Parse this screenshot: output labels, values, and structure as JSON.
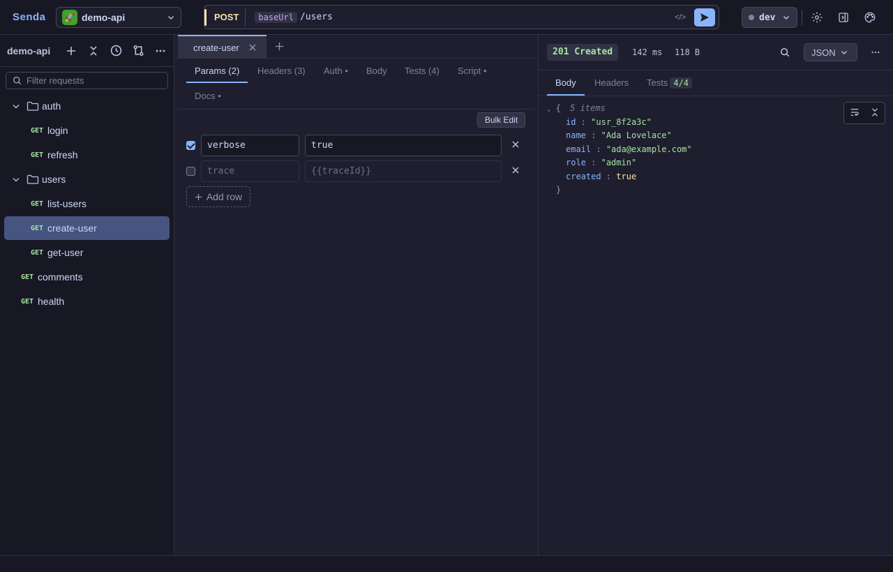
{
  "app": {
    "brand": "Senda"
  },
  "workspace": {
    "name": "demo-api",
    "icon": "rocket-icon"
  },
  "request_bar": {
    "method": "POST",
    "url_var": "baseUrl",
    "url_path": "/users"
  },
  "environment": {
    "name": "dev"
  },
  "sidebar": {
    "title": "demo-api",
    "filter_placeholder": "Filter requests",
    "tree": [
      {
        "type": "folder",
        "name": "auth"
      },
      {
        "type": "request",
        "method": "GET",
        "name": "login"
      },
      {
        "type": "request",
        "method": "GET",
        "name": "refresh"
      },
      {
        "type": "folder",
        "name": "users"
      },
      {
        "type": "request",
        "method": "GET",
        "name": "list-users"
      },
      {
        "type": "request",
        "method": "GET",
        "name": "create-user",
        "active": true
      },
      {
        "type": "request",
        "method": "GET",
        "name": "get-user"
      },
      {
        "type": "request",
        "method": "GET",
        "name": "comments"
      },
      {
        "type": "request",
        "method": "GET",
        "name": "health"
      }
    ]
  },
  "request": {
    "tab_name": "create-user",
    "subtabs": [
      "Params (2)",
      "Headers (3)",
      "Auth •",
      "Body",
      "Tests (4)",
      "Script •",
      "Docs •"
    ],
    "bulk_edit": "Bulk Edit",
    "params": [
      {
        "enabled": true,
        "key": "verbose",
        "value": "true"
      },
      {
        "enabled": false,
        "key": "trace",
        "value": "{{traceId}}"
      }
    ],
    "add_row": "Add row"
  },
  "response": {
    "status": "201 Created",
    "time": "142 ms",
    "size": "118 B",
    "format": "JSON",
    "tabs": [
      "Body",
      "Headers",
      "Tests"
    ],
    "tests_badge": "4/4",
    "json": {
      "summary": "5 items",
      "open": "{",
      "close": "}",
      "fields": [
        {
          "key": "id",
          "value": "\"usr_8f2a3c\"",
          "kind": "string"
        },
        {
          "key": "name",
          "value": "\"Ada Lovelace\"",
          "kind": "string"
        },
        {
          "key": "email",
          "value": "\"ada@example.com\"",
          "kind": "string"
        },
        {
          "key": "role",
          "value": "\"admin\"",
          "kind": "string"
        },
        {
          "key": "created",
          "value": "true",
          "kind": "bool"
        }
      ]
    }
  },
  "colors": {
    "accent": "#89b4fa",
    "method_post": "#f9e2af",
    "method_get": "#a6e3a1",
    "status_ok": "#a6e3a1"
  }
}
